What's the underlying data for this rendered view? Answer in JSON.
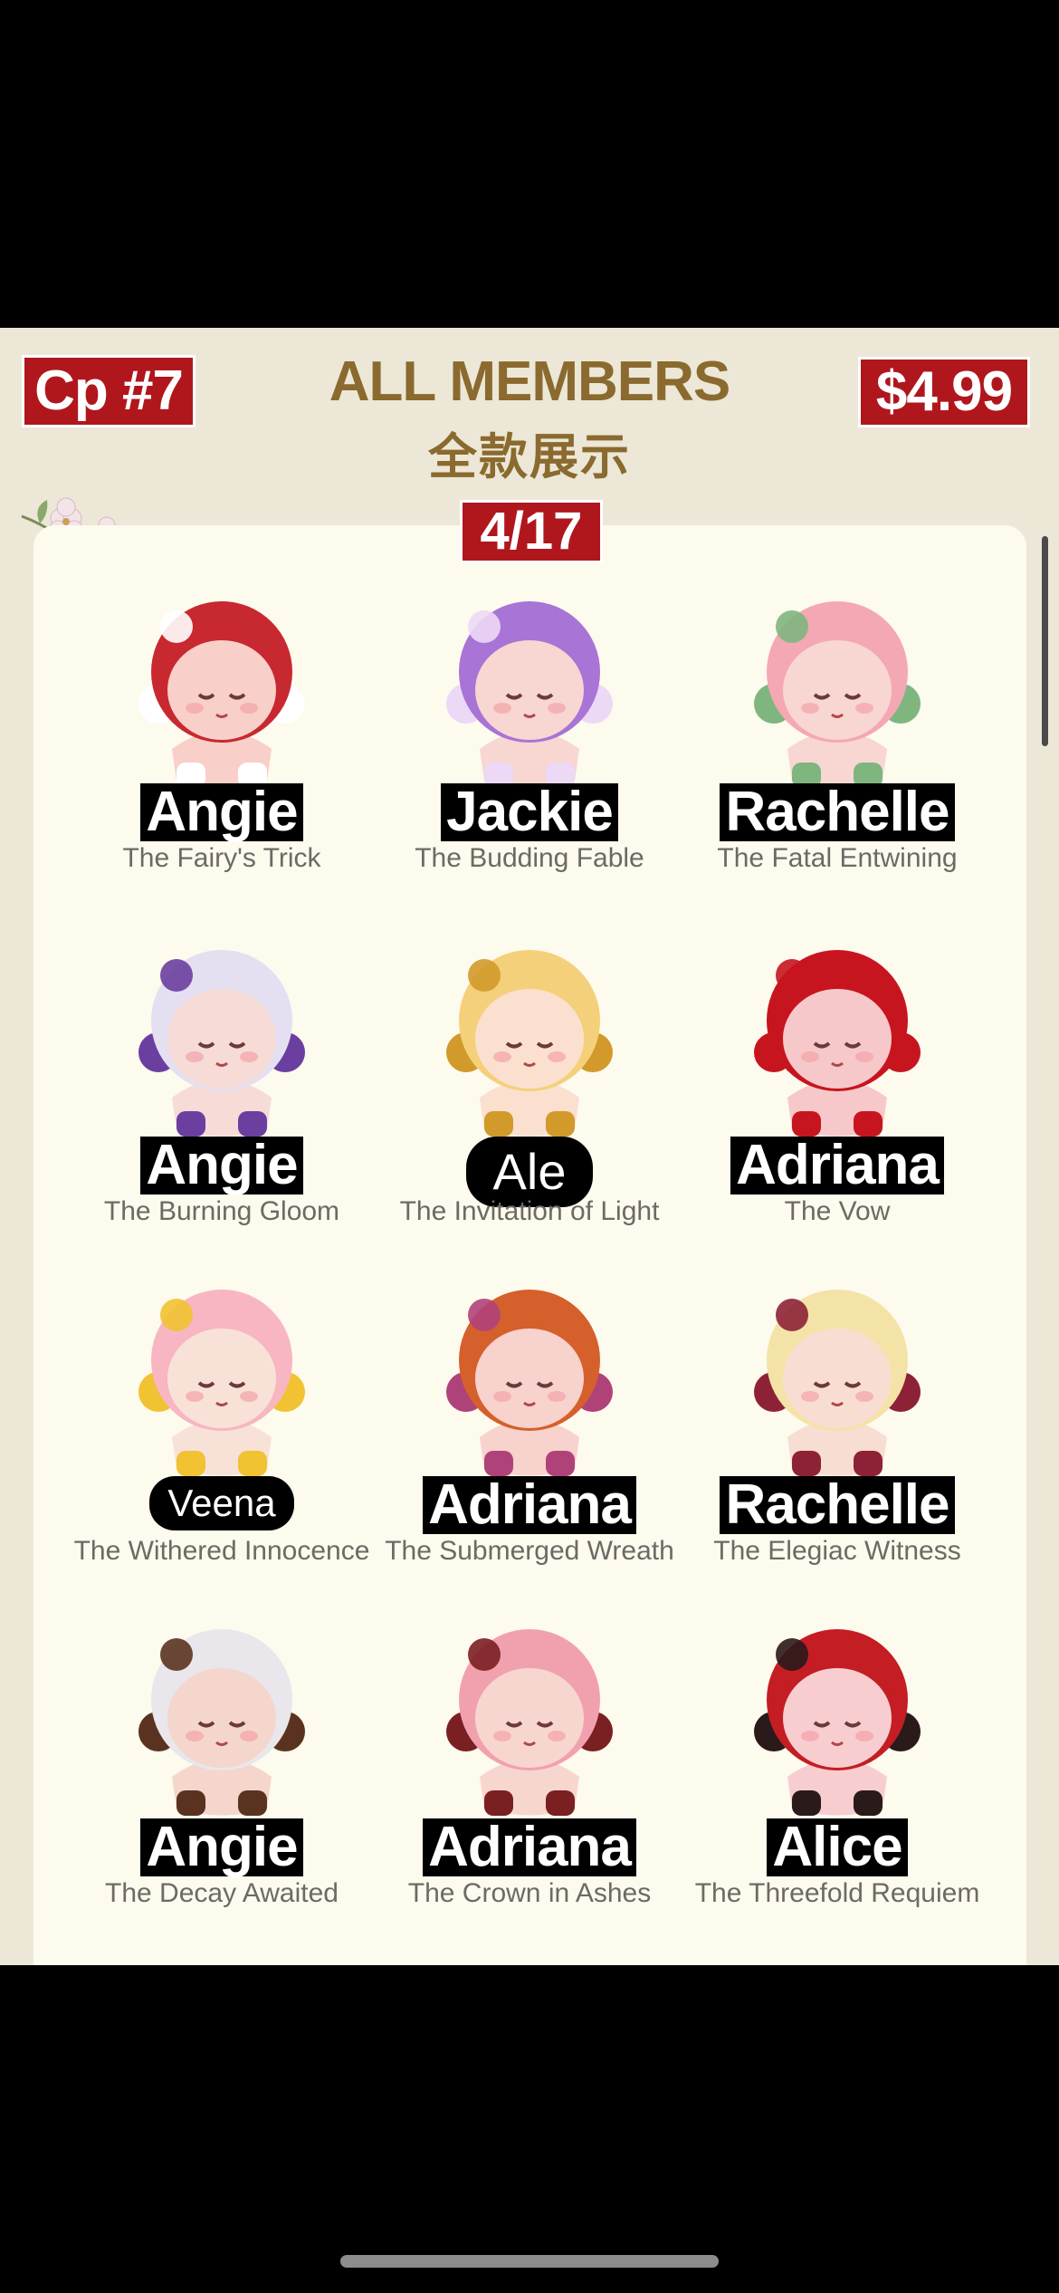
{
  "header": {
    "tag_left": "Cp #7",
    "tag_right": "$4.99",
    "title_en": "ALL MEMBERS",
    "title_cn": "全款展示",
    "page_indicator": "4/17"
  },
  "colors": {
    "panel_bg": "#ece7d7",
    "card_bg": "#fdfaee",
    "tag_red": "#b0171d",
    "title_gold": "#8a6a2e"
  },
  "figures": [
    {
      "name": "Angie",
      "subtitle": "The Fairy's Trick",
      "hair": "#c8282f",
      "skin": "#f8cfc9",
      "accent": "#ffffff",
      "icon": "flower-icon"
    },
    {
      "name": "Jackie",
      "subtitle": "The Budding Fable",
      "hair": "#a874d6",
      "skin": "#f8d6d2",
      "accent": "#ecd9f5",
      "icon": "petal-icon"
    },
    {
      "name": "Rachelle",
      "subtitle": "The Fatal Entwining",
      "hair": "#f3a8b3",
      "skin": "#f8d6d2",
      "accent": "#7fb57f",
      "icon": "leaf-icon"
    },
    {
      "name": "Angie",
      "subtitle": "The Burning Gloom",
      "hair": "#e4e0f2",
      "skin": "#f6dbd6",
      "accent": "#6a3fa0",
      "icon": "star-icon"
    },
    {
      "name": "Ale",
      "subtitle": "The Invitation of Light",
      "hair": "#f5d07a",
      "skin": "#fbe0cf",
      "accent": "#d19a2a",
      "icon": "bell-icon"
    },
    {
      "name": "Adriana",
      "subtitle": "The Vow",
      "hair": "#c7151f",
      "skin": "#f7c8ca",
      "accent": "#c7151f",
      "icon": "rose-icon"
    },
    {
      "name": "Veena",
      "subtitle": "The Withered Innocence",
      "hair": "#f7b6c2",
      "skin": "#f8e2d8",
      "accent": "#f1c232",
      "icon": "ball-icon"
    },
    {
      "name": "Adriana",
      "subtitle": "The Submerged Wreath",
      "hair": "#d5602b",
      "skin": "#f8d2cc",
      "accent": "#b0427a",
      "icon": "wreath-icon"
    },
    {
      "name": "Rachelle",
      "subtitle": "The Elegiac Witness",
      "hair": "#f4e3a6",
      "skin": "#f8ddd2",
      "accent": "#8d2236",
      "icon": "petal-icon"
    },
    {
      "name": "Angie",
      "subtitle": "The Decay Awaited",
      "hair": "#e9e6ec",
      "skin": "#f4d6cc",
      "accent": "#5a3320",
      "icon": "crown-icon"
    },
    {
      "name": "Adriana",
      "subtitle": "The Crown in Ashes",
      "hair": "#f1a1ae",
      "skin": "#f8d6d0",
      "accent": "#7a1f22",
      "icon": "hood-icon"
    },
    {
      "name": "Alice",
      "subtitle": "The Threefold Requiem",
      "hair": "#c41d24",
      "skin": "#f7cdd0",
      "accent": "#2a1a1a",
      "icon": "bow-icon"
    }
  ]
}
